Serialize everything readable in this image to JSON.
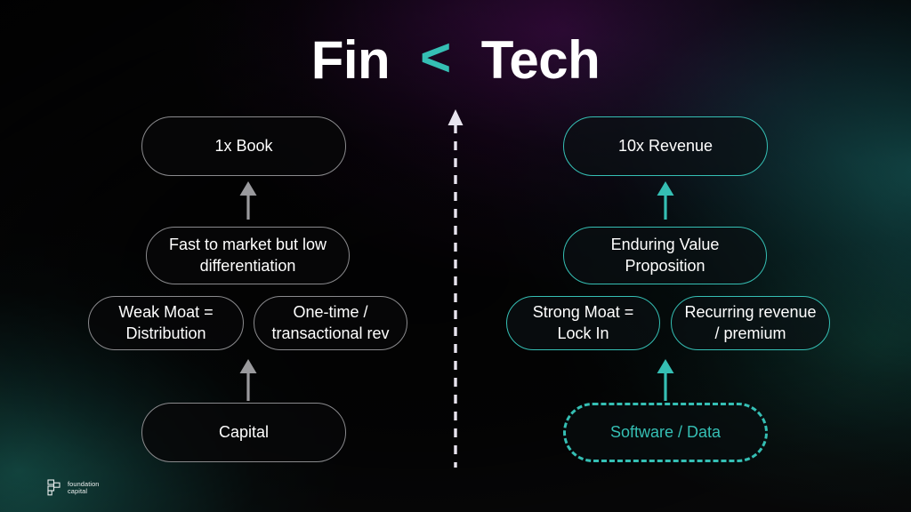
{
  "slide": {
    "title": {
      "left_word": "Fin",
      "comparator": "<",
      "right_word": "Tech"
    },
    "colors": {
      "teal": "#35bfb4",
      "gray_border": "#8a8a8d",
      "white": "#ffffff",
      "box_fill": "#08080a",
      "bg_purple": "#79188c",
      "bg_teal": "#269696",
      "bg_green": "#186058",
      "bg_black": "#080809"
    },
    "left_column": {
      "name": "Fin",
      "boxes": {
        "top": "1x Book",
        "middle": "Fast to market but low differentiation",
        "left_pill": "Weak Moat = Distribution",
        "right_pill": "One-time / transactional rev",
        "bottom": "Capital"
      }
    },
    "right_column": {
      "name": "Tech",
      "boxes": {
        "top": "10x Revenue",
        "middle": "Enduring Value Proposition",
        "left_pill": "Strong Moat = Lock In",
        "right_pill": "Recurring revenue / premium",
        "bottom": "Software / Data"
      }
    },
    "divider": {
      "style": "dashed-vertical-arrow-up"
    },
    "logo": {
      "line1": "foundation",
      "line2": "capital"
    }
  }
}
